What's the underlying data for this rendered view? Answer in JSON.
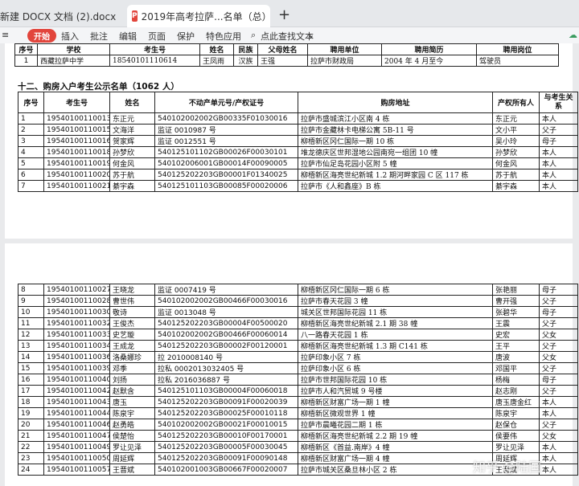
{
  "tabs": {
    "tab1_title": "新建 DOCX 文档 (2).docx",
    "tab2_title": "2019年高考拉萨...名单（总）.pdf",
    "pdf_label": "P",
    "close": "×",
    "new": "+"
  },
  "toolbar": {
    "menu": "≡",
    "start": "开始",
    "items": [
      "插入",
      "批注",
      "编辑",
      "页面",
      "保护",
      "特色应用"
    ],
    "search": "点此查找文本"
  },
  "top_table": {
    "headers": [
      "序号",
      "学校",
      "考生号",
      "姓名",
      "民族",
      "父母姓名",
      "聘用单位",
      "聘用简历",
      "聘用岗位"
    ],
    "row": [
      "1",
      "西藏拉萨中学",
      "18540101110614",
      "王凤雨",
      "汉族",
      "王强",
      "拉萨市财政局",
      "2004 年 4 月至今",
      "驾驶员"
    ]
  },
  "section_title": "十二、购房入户考生公示名单（1062 人）",
  "main_headers": [
    "序号",
    "考生号",
    "姓名",
    "不动产单元号/产权证号",
    "购房地址",
    "产权所有人",
    "与考生关系"
  ],
  "rows_p1": [
    [
      "1",
      "19540100110013",
      "东正元",
      "540102002002GB00335F01030016",
      "拉萨市盛城滨江小区南 4 栋",
      "东正元",
      "本人"
    ],
    [
      "2",
      "19540100110015",
      "文海洋",
      "监证 0010987 号",
      "拉萨市金藏林卡电梯公寓 5B-11 号",
      "文小平",
      "父子"
    ],
    [
      "3",
      "19540100110016",
      "贺家辉",
      "监证 0012551 号",
      "柳梧新区冈仁国际一期 10 栋",
      "吴小玲",
      "母子"
    ],
    [
      "4",
      "19540100110018",
      "孙梦欣",
      "540125101102GB00026F00030101",
      "堆龙德庆区世邦湿地公园南宛一组团 10 幢",
      "孙梦欣",
      "本人"
    ],
    [
      "5",
      "19540100110019",
      "何金风",
      "540102006001GB00014F00090005",
      "拉萨市仙足岛花园小区附 5 幢",
      "何金风",
      "本人"
    ],
    [
      "6",
      "19540100110020",
      "苏于航",
      "540125202203GB00001F01340025",
      "柳梧新区海亮世纪新城 1.2 期河畔家园 C 区 117 栋",
      "苏于航",
      "本人"
    ],
    [
      "7",
      "19540100110021",
      "綦宇森",
      "540125101103GB00085F00020006",
      "拉萨市《人和鑫座》B 栋",
      "綦宇森",
      "本人"
    ]
  ],
  "rows_p2": [
    [
      "8",
      "19540100110027",
      "王晓龙",
      "监证 0007419 号",
      "柳梧新区冈仁国际一期 6 栋",
      "张艳丽",
      "母子"
    ],
    [
      "9",
      "19540100110028",
      "曹世伟",
      "540102002002GB00466F00030016",
      "拉萨市春天花园 3 幢",
      "曹开强",
      "父子"
    ],
    [
      "10",
      "19540100110030",
      "敬诗",
      "监证 0013048 号",
      "城关区世邦国际花园 11 栋",
      "张碧华",
      "母子"
    ],
    [
      "11",
      "19540100110032",
      "王俊杰",
      "540125202203GB00004F00500020",
      "柳梧新区海亮世纪新城 2.1 期 38 幢",
      "王震",
      "父子"
    ],
    [
      "12",
      "19540100110033",
      "史艺璇",
      "540102002002GB00466F00060014",
      "八一路春天花园 1 栋",
      "史宏",
      "父女"
    ],
    [
      "13",
      "19540100110034",
      "王成龙",
      "540125202203GB00002F00120001",
      "柳梧新区海亮世纪新城 1.3 期 C141 栋",
      "王平",
      "父子"
    ],
    [
      "14",
      "19540100110036",
      "洛桑娜珍",
      "拉 2010008140 号",
      "拉萨印象小区 7 栋",
      "唐波",
      "父女"
    ],
    [
      "15",
      "19540100110039",
      "邓季",
      "拉私 0002013032405 号",
      "拉萨印象小区 6 栋",
      "邓国平",
      "父子"
    ],
    [
      "16",
      "19540100110040",
      "刘扬",
      "拉私 2016036887 号",
      "拉萨市世邦国际花园 10 栋",
      "杨梅",
      "母子"
    ],
    [
      "17",
      "19540100110042",
      "赵默含",
      "540125101103GB00004F00060018",
      "拉萨市人和汽贸城 9 号楼",
      "赵志刚",
      "父子"
    ],
    [
      "18",
      "19540100110043",
      "唐玉",
      "540125202203GB00091F00020039",
      "柳梧新区财富广场一期 1 幢",
      "唐玉唐金红",
      "本人"
    ],
    [
      "19",
      "19540100110044",
      "陈泉宇",
      "540125202203GB00025F00010118",
      "柳梧新区微观世界 1 幢",
      "陈泉宇",
      "本人"
    ],
    [
      "20",
      "19540100110046",
      "赵勇皓",
      "540102002002GB00021F00010015",
      "拉萨市晨曦花园二期 1 栋",
      "赵保仓",
      "父子"
    ],
    [
      "21",
      "19540100110047",
      "侯楚怡",
      "540125202203GB00010F00170001",
      "柳梧新区海亮世纪新城 2.2 期 19 幢",
      "侯要伟",
      "父女"
    ],
    [
      "22",
      "19540100110049",
      "罗让见泽",
      "540125202203GB00005F00030045",
      "柳梧新区《首益.南岸》4 幢",
      "罗让见泽",
      "本人"
    ],
    [
      "23",
      "19540100110050",
      "周延辉",
      "540125202203GB00091F00090148",
      "柳梧新区财富广场一期 4 幢",
      "周延辉",
      "本人"
    ],
    [
      "24",
      "19540100110057",
      "王晋斌",
      "540102001003GB00667F00020007",
      "拉萨市城关区桑旦林小区 2 栋",
      "王晋斌",
      "本人"
    ]
  ],
  "watermark": "知乎 @陆国"
}
